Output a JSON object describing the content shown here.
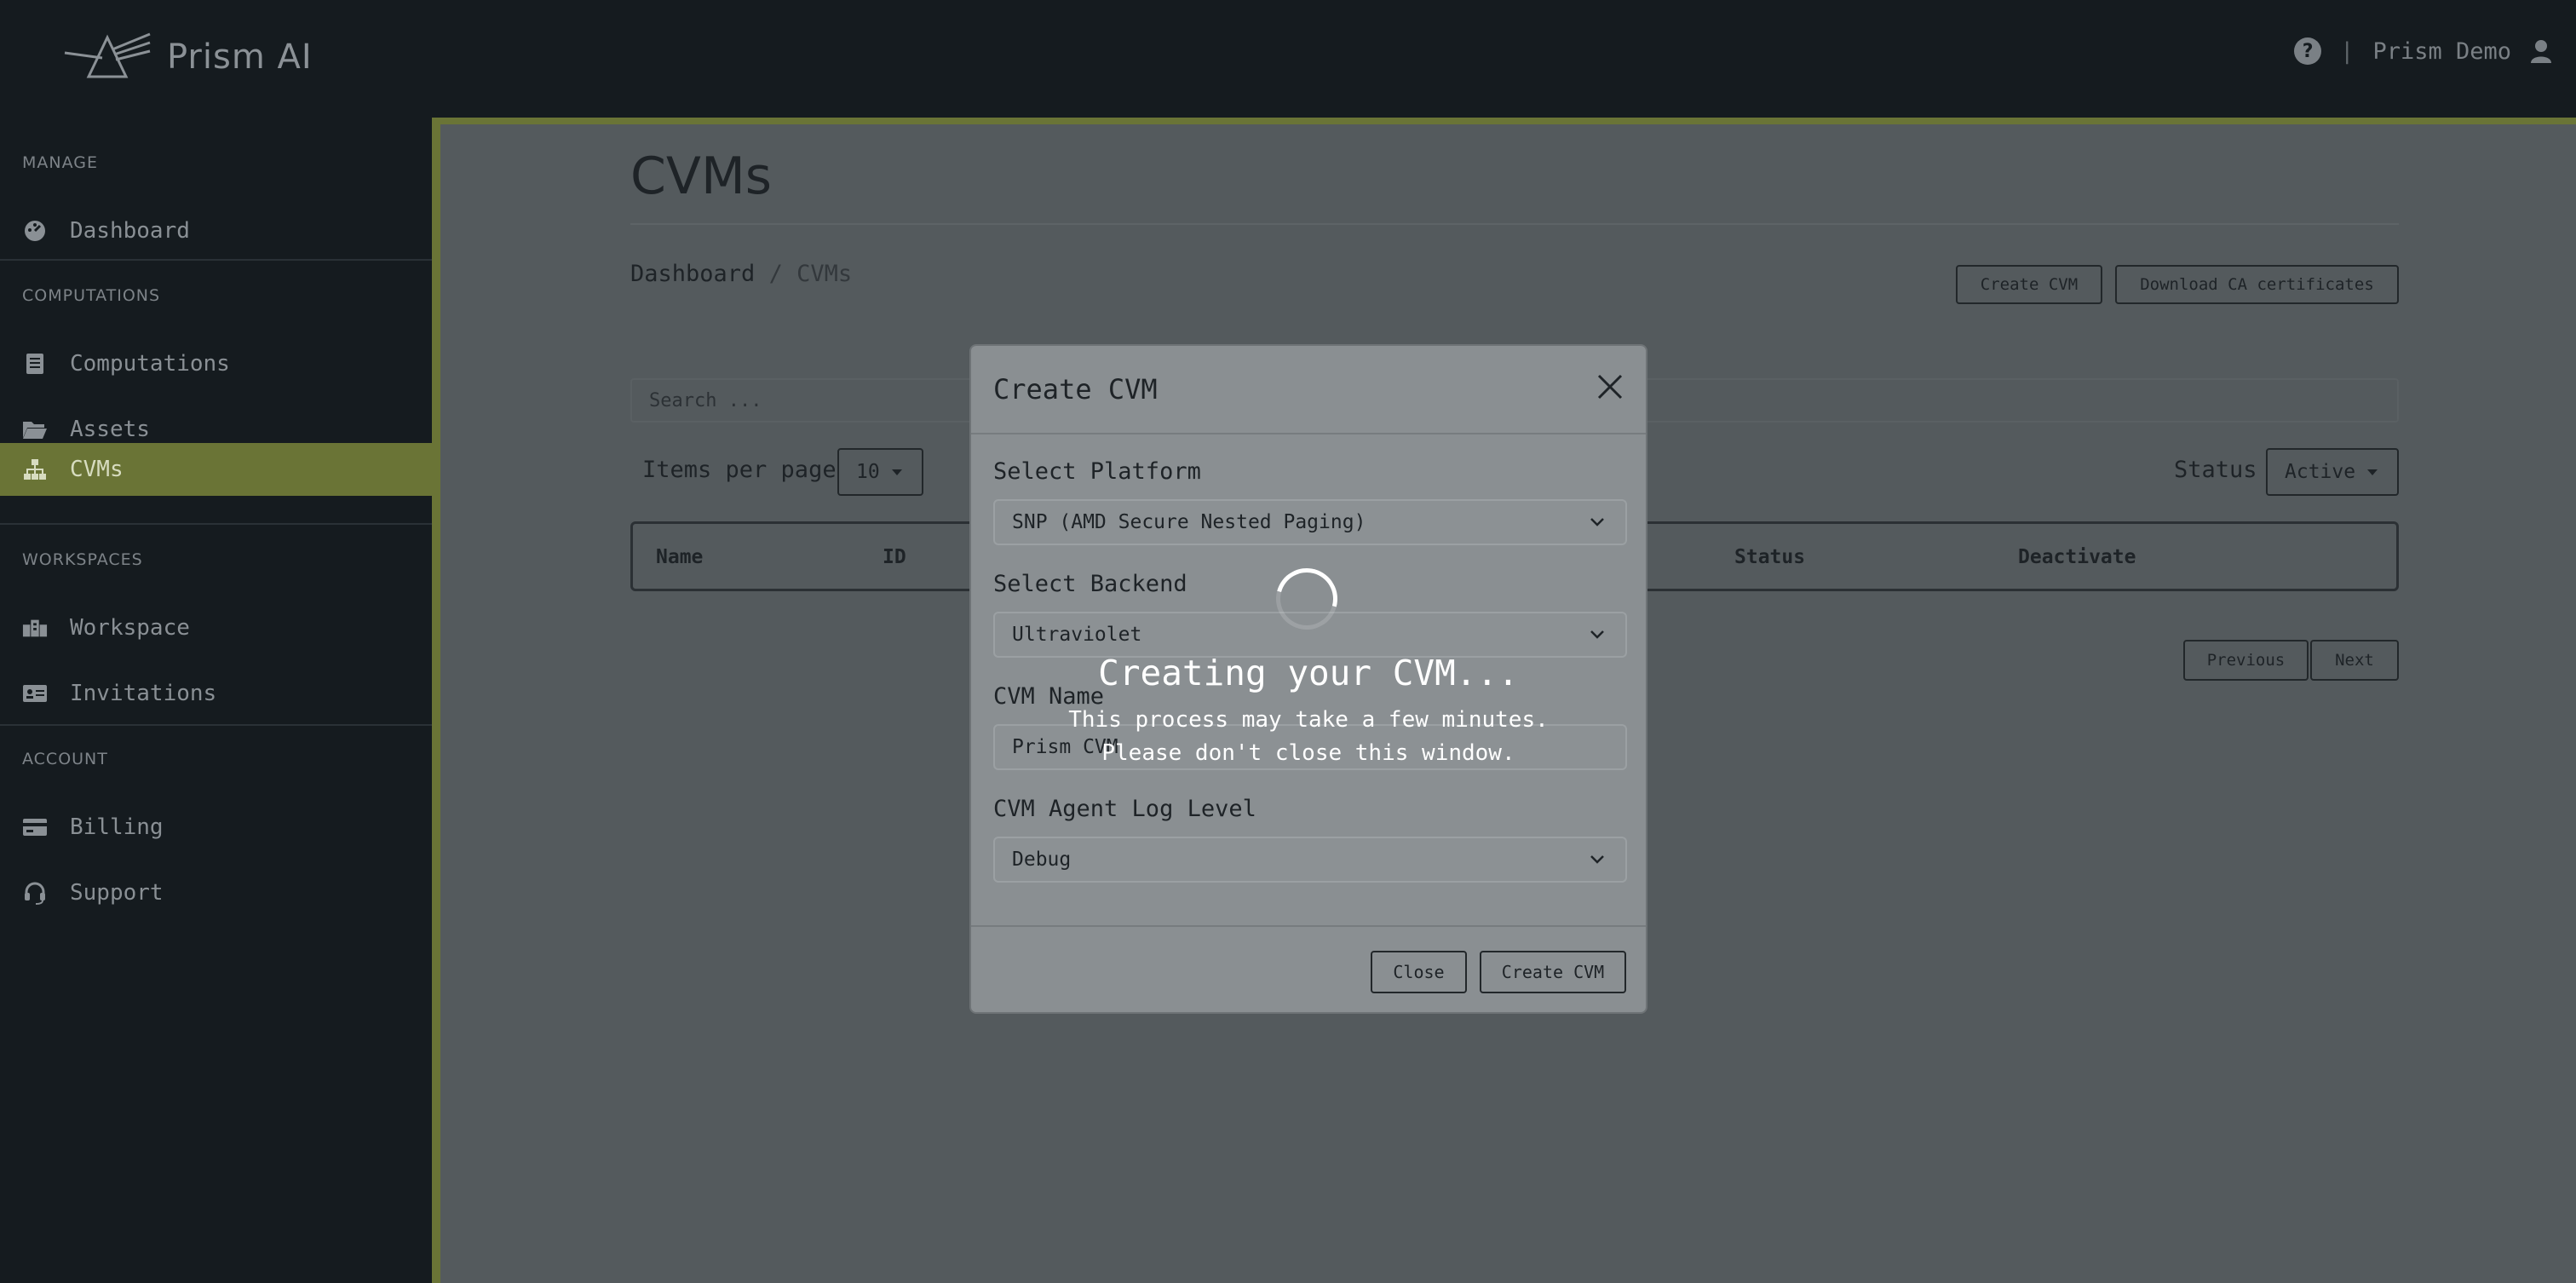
{
  "app": {
    "brand_name": "Prism AI",
    "user_name": "Prism Demo",
    "help_glyph": "?",
    "separator": "|"
  },
  "sidebar": {
    "sections": [
      {
        "label": "MANAGE",
        "items": [
          {
            "label": "Dashboard",
            "icon": "speedometer-icon"
          }
        ]
      },
      {
        "label": "COMPUTATIONS",
        "items": [
          {
            "label": "Computations",
            "icon": "document-icon"
          },
          {
            "label": "Assets",
            "icon": "folder-icon"
          },
          {
            "label": "CVMs",
            "icon": "sitemap-icon",
            "active": true
          }
        ]
      },
      {
        "label": "WORKSPACES",
        "items": [
          {
            "label": "Workspace",
            "icon": "buildings-icon"
          },
          {
            "label": "Invitations",
            "icon": "id-card-icon"
          }
        ]
      },
      {
        "label": "ACCOUNT",
        "items": [
          {
            "label": "Billing",
            "icon": "credit-card-icon"
          },
          {
            "label": "Support",
            "icon": "headset-icon"
          }
        ]
      }
    ]
  },
  "page": {
    "title": "CVMs",
    "breadcrumb": {
      "root": "Dashboard",
      "separator": "/",
      "current": "CVMs"
    },
    "actions": {
      "create": "Create CVM",
      "download": "Download CA certificates"
    },
    "search_placeholder": "Search ...",
    "items_per_page_label": "Items per page",
    "items_per_page_value": "10",
    "status_label": "Status",
    "status_value": "Active",
    "table_columns": [
      "Name",
      "ID",
      "Status",
      "Deactivate"
    ],
    "pagination": {
      "previous": "Previous",
      "next": "Next"
    }
  },
  "modal": {
    "title": "Create CVM",
    "fields": {
      "platform": {
        "label": "Select Platform",
        "value": "SNP (AMD Secure Nested Paging)"
      },
      "backend": {
        "label": "Select Backend",
        "value": "Ultraviolet"
      },
      "name": {
        "label": "CVM Name",
        "value": "Prism CVM"
      },
      "log_level": {
        "label": "CVM Agent Log Level",
        "value": "Debug"
      }
    },
    "buttons": {
      "close": "Close",
      "create": "Create CVM"
    },
    "loading": {
      "title": "Creating your CVM...",
      "line1": "This process may take a few minutes.",
      "line2": "Please don't close this window."
    }
  },
  "colors": {
    "accent": "#6a7436",
    "topbar": "#151b1f",
    "modal_bg": "#8a8f92"
  }
}
